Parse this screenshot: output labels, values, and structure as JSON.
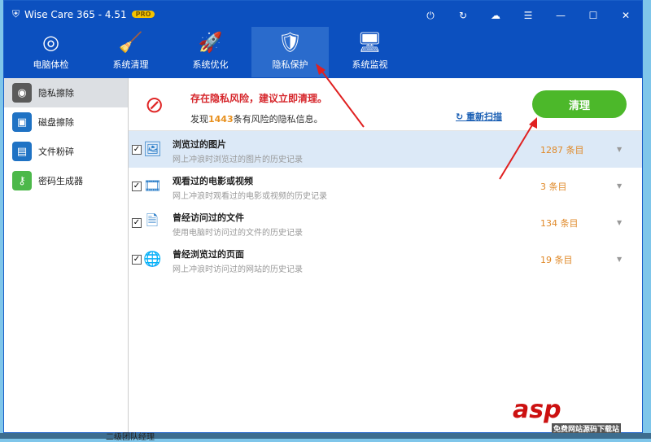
{
  "window": {
    "title": "Wise Care 365 - 4.51",
    "badge": "PRO",
    "controls": [
      "⏻",
      "↻",
      "☁",
      "☰",
      "—",
      "☐",
      "✕"
    ]
  },
  "tabs": [
    {
      "label": "电脑体检",
      "icon": "radar-icon",
      "glyph": "◎"
    },
    {
      "label": "系统清理",
      "icon": "broom-icon",
      "glyph": "🧹"
    },
    {
      "label": "系统优化",
      "icon": "rocket-icon",
      "glyph": "🚀"
    },
    {
      "label": "隐私保护",
      "icon": "shield-icon",
      "glyph": "🛡"
    },
    {
      "label": "系统监视",
      "icon": "monitor-icon",
      "glyph": "🖥"
    }
  ],
  "sidebar": [
    {
      "label": "隐私擦除",
      "icon": "eye-slash-icon",
      "glyph": "◉",
      "color": "#5a5a5a"
    },
    {
      "label": "磁盘擦除",
      "icon": "disk-icon",
      "glyph": "▣",
      "color": "#1f72c4"
    },
    {
      "label": "文件粉碎",
      "icon": "shredder-icon",
      "glyph": "▤",
      "color": "#1f72c4"
    },
    {
      "label": "密码生成器",
      "icon": "key-icon",
      "glyph": "⚷",
      "color": "#4cb84a"
    }
  ],
  "header": {
    "warning": "存在隐私风险，建议立即清理。",
    "found_prefix": "发现",
    "found_count": "1443",
    "found_suffix": "条有风险的隐私信息。",
    "rescan": "重新扫描",
    "clean": "清理"
  },
  "rows": [
    {
      "title": "浏览过的图片",
      "desc": "网上冲浪时浏览过的图片的历史记录",
      "count": "1287 条目",
      "icon": "image-icon",
      "glyph": "🖼"
    },
    {
      "title": "观看过的电影或视频",
      "desc": "网上冲浪时观看过的电影或视频的历史记录",
      "count": "3 条目",
      "icon": "film-icon",
      "glyph": "🎞"
    },
    {
      "title": "曾经访问过的文件",
      "desc": "使用电脑时访问过的文件的历史记录",
      "count": "134 条目",
      "icon": "document-icon",
      "glyph": "🗎"
    },
    {
      "title": "曾经浏览过的页面",
      "desc": "网上冲浪时访问过的网站的历史记录",
      "count": "19 条目",
      "icon": "globe-icon",
      "glyph": "🌐"
    }
  ],
  "watermark": {
    "text": "asp",
    "sub": "免费网站源码下载站"
  },
  "taskbar": {
    "text": "二级团队经理"
  }
}
